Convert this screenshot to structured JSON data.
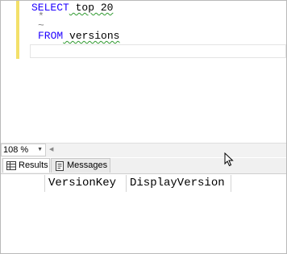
{
  "editor": {
    "lines": [
      {
        "keyword": "SELECT",
        "rest": " top 20"
      },
      {
        "operator": "*"
      },
      {
        "operator": "~"
      },
      {
        "keyword": "FROM",
        "rest": " versions"
      }
    ]
  },
  "statusbar": {
    "zoom": "108 %",
    "zoom_caret": "▼",
    "scroll_left": "◀"
  },
  "tabs": [
    {
      "label": "Results",
      "icon": "grid-icon"
    },
    {
      "label": "Messages",
      "icon": "messages-icon"
    }
  ],
  "results": {
    "columns": [
      "VersionKey",
      "DisplayVersion"
    ]
  },
  "colors": {
    "keyword": "#1f00ff",
    "squiggle": "#2f9a2f",
    "change_bar": "#f3e06a"
  }
}
